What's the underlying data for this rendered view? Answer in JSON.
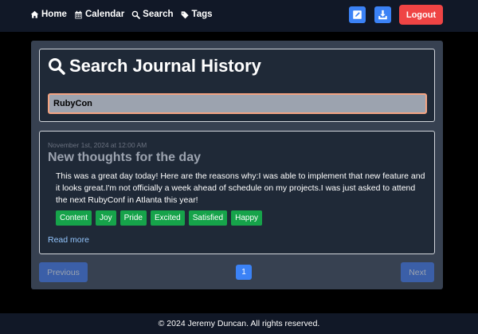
{
  "nav": {
    "links": [
      {
        "label": "Home",
        "icon": "home-icon"
      },
      {
        "label": "Calendar",
        "icon": "calendar-icon"
      },
      {
        "label": "Search",
        "icon": "search-icon"
      },
      {
        "label": "Tags",
        "icon": "tags-icon"
      }
    ],
    "logout_label": "Logout"
  },
  "search": {
    "title": "Search Journal History",
    "value": "RubyCon"
  },
  "entry": {
    "date": "November 1st, 2024 at 12:00 AM",
    "title": "New thoughts for the day",
    "body": "This was a great day today! Here are the reasons why:I was able to implement that new feature and it looks great.I'm not officially a week ahead of schedule on my projects.I was just asked to attend the next RubyConf in Atlanta this year!",
    "tags": [
      "Content",
      "Joy",
      "Pride",
      "Excited",
      "Satisfied",
      "Happy"
    ],
    "read_more": "Read more"
  },
  "pagination": {
    "previous": "Previous",
    "current_page": "1",
    "next": "Next"
  },
  "footer": {
    "text": "© 2024 Jeremy Duncan. All rights reserved."
  },
  "colors": {
    "accent": "#3b82f6",
    "danger": "#ef4444",
    "tag": "#16a34a",
    "panel": "#374151",
    "card": "#1f2937"
  }
}
